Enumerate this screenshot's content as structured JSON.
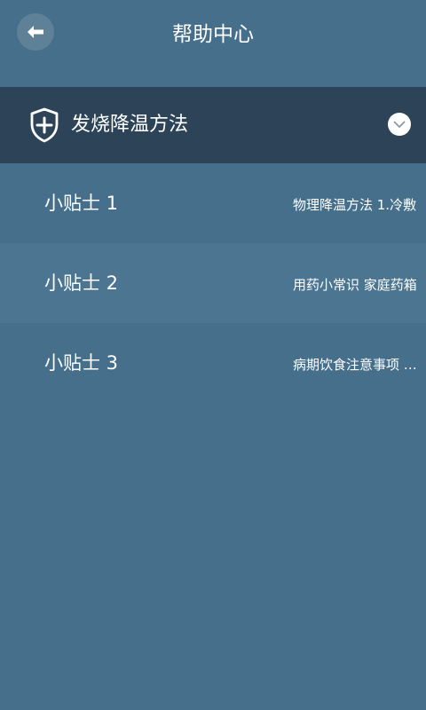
{
  "header": {
    "title": "帮助中心",
    "back_icon": "arrow-left-icon"
  },
  "section": {
    "title": "发烧降温方法",
    "icon": "shield-plus-icon",
    "toggle_icon": "chevron-down-icon"
  },
  "items": [
    {
      "label": "小贴士 1",
      "preview": "物理降温方法 1.冷敷"
    },
    {
      "label": "小贴士 2",
      "preview": "用药小常识 家庭药箱"
    },
    {
      "label": "小贴士 3",
      "preview": "病期饮食注意事项 多喝水"
    }
  ],
  "colors": {
    "background": "#466f8c",
    "section_header": "#2d4458",
    "row_alt": "#4b7590",
    "text": "#ffffff"
  }
}
